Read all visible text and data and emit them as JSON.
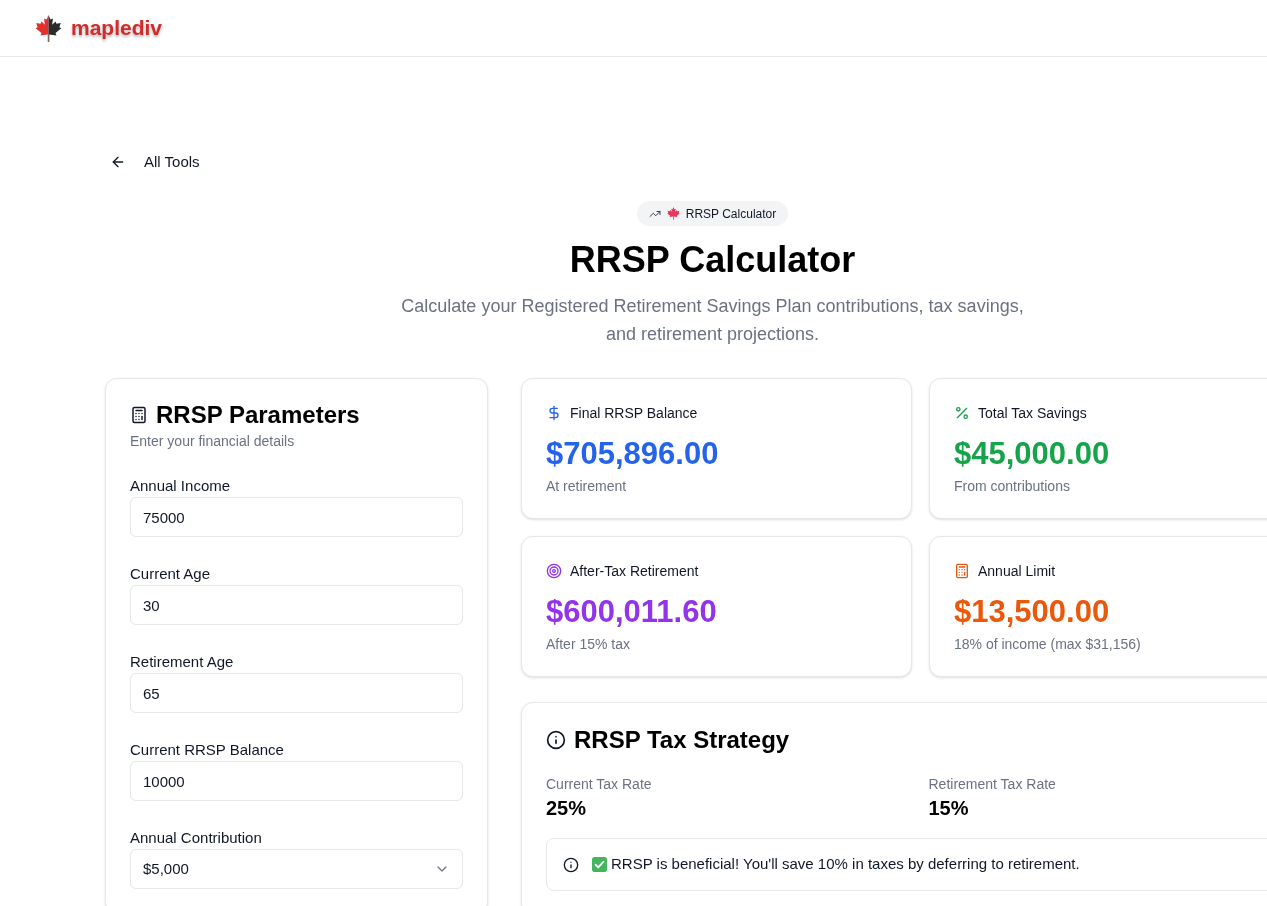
{
  "header": {
    "logo_text": "maplediv"
  },
  "back_link": {
    "label": "All Tools"
  },
  "hero": {
    "badge": "RRSP Calculator",
    "title": "RRSP Calculator",
    "subtitle": "Calculate your Registered Retirement Savings Plan contributions, tax savings, and retirement projections."
  },
  "parameters": {
    "title": "RRSP Parameters",
    "subtitle": "Enter your financial details",
    "fields": [
      {
        "kind": "input",
        "label": "Annual Income",
        "value": "75000"
      },
      {
        "kind": "input",
        "label": "Current Age",
        "value": "30"
      },
      {
        "kind": "input",
        "label": "Retirement Age",
        "value": "65"
      },
      {
        "kind": "input",
        "label": "Current RRSP Balance",
        "value": "10000"
      },
      {
        "kind": "select",
        "label": "Annual Contribution",
        "value": "$5,000"
      }
    ]
  },
  "stats": [
    {
      "kind": "dollar",
      "label": "Final RRSP Balance",
      "value": "$705,896.00",
      "note": "At retirement",
      "color": "#2563eb"
    },
    {
      "kind": "percent",
      "label": "Total Tax Savings",
      "value": "$45,000.00",
      "note": "From contributions",
      "color": "#16a34a"
    },
    {
      "kind": "target",
      "label": "After-Tax Retirement",
      "value": "$600,011.60",
      "note": "After 15% tax",
      "color": "#9333ea"
    },
    {
      "kind": "calculator",
      "label": "Annual Limit",
      "value": "$13,500.00",
      "note": "18% of income (max $31,156)",
      "color": "#ea580c"
    }
  ],
  "tax_strategy": {
    "title": "RRSP Tax Strategy",
    "rates": [
      {
        "label": "Current Tax Rate",
        "value": "25%"
      },
      {
        "label": "Retirement Tax Rate",
        "value": "15%"
      }
    ],
    "alert": {
      "text": "RRSP is beneficial! You'll save 10% in taxes by deferring to retirement."
    }
  }
}
